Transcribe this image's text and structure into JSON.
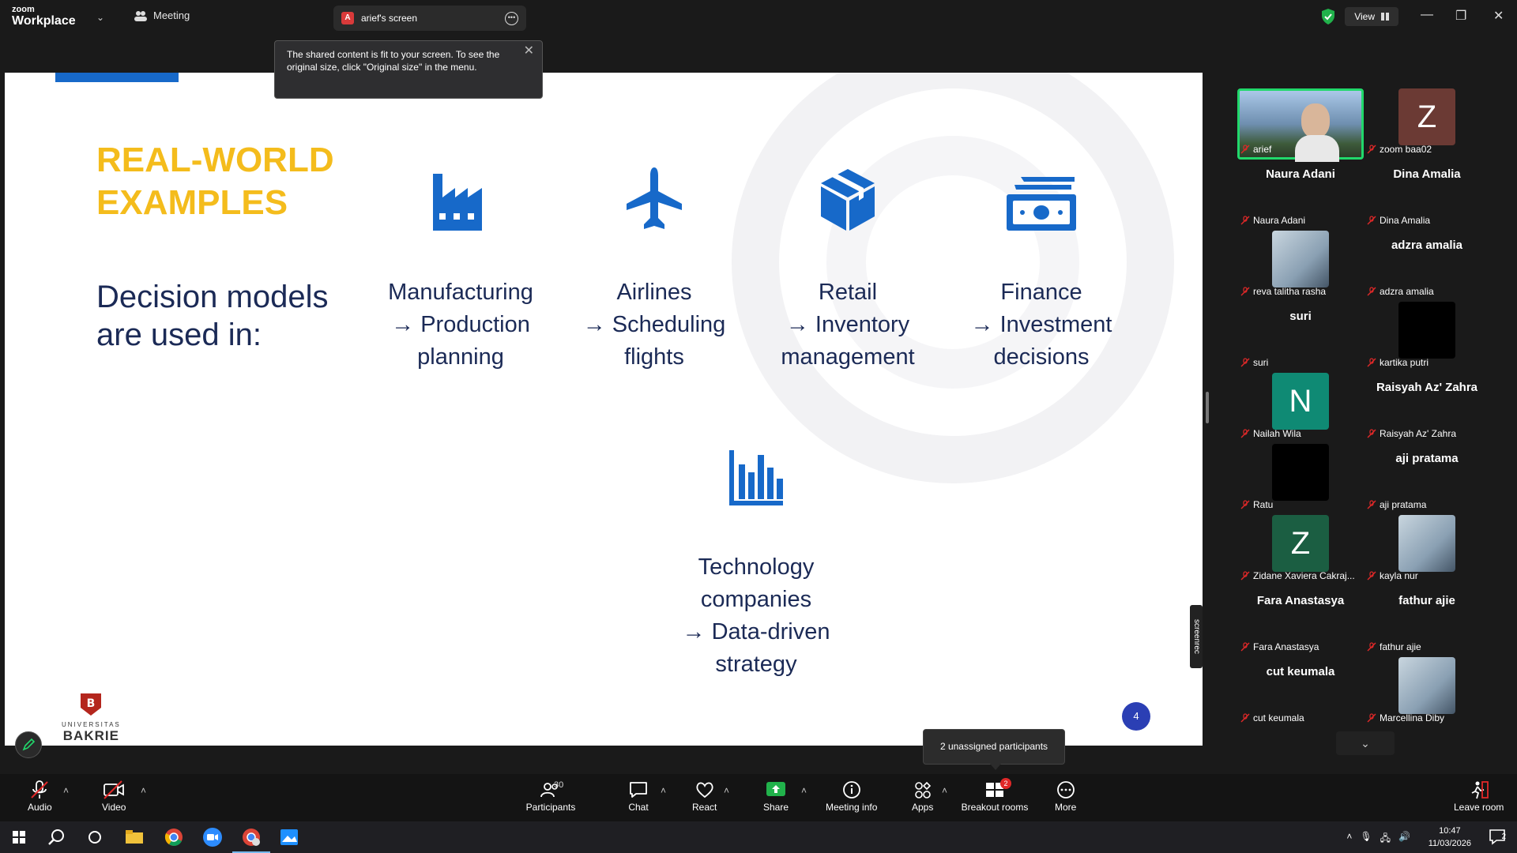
{
  "topbar": {
    "logo_small": "zoom",
    "logo_big": "Workplace",
    "meeting_label": "Meeting",
    "share_avatar": "A",
    "share_title": "arief's screen",
    "view_label": "View"
  },
  "tooltip": {
    "text": "The shared content is fit to your screen. To see the original size, click \"Original size\" in the menu."
  },
  "slide": {
    "title_line1": "REAL-WORLD",
    "title_line2": "EXAMPLES",
    "subtitle": "Decision models are used in:",
    "examples": [
      {
        "icon": "factory-icon",
        "label": "Manufacturing\n→ Production\nplanning"
      },
      {
        "icon": "airplane-icon",
        "label": "Airlines\n→ Scheduling\nflights"
      },
      {
        "icon": "package-icon",
        "label": "Retail\n→ Inventory\nmanagement"
      },
      {
        "icon": "money-icon",
        "label": "Finance\n→ Investment\ndecisions"
      },
      {
        "icon": "bar-chart-icon",
        "label": "Technology\ncompanies\n→ Data-driven\nstrategy"
      }
    ],
    "logo_crest": "B",
    "logo_uni": "UNIVERSITAS",
    "logo_name": "BAKRIE",
    "page_number": "4",
    "accent_blue": "#1769c9",
    "title_color": "#f4bc1c"
  },
  "screenrec": "screenrec",
  "participants": [
    {
      "label": "arief",
      "kind": "video"
    },
    {
      "label": "zoom baa02",
      "kind": "avatar",
      "initial": "Z",
      "color": "#6b3a34"
    },
    {
      "label": "Naura Adani",
      "big": "Naura Adani"
    },
    {
      "label": "Dina Amalia",
      "big": "Dina Amalia"
    },
    {
      "label": "reva talitha rasha",
      "kind": "photo"
    },
    {
      "label": "adzra amalia",
      "big": "adzra amalia"
    },
    {
      "label": "suri",
      "big": "suri"
    },
    {
      "label": "kartika putri",
      "kind": "black"
    },
    {
      "label": "Nailah Wila",
      "kind": "avatar",
      "initial": "N",
      "color": "#0f8a74"
    },
    {
      "label": "Raisyah Az' Zahra",
      "big": "Raisyah Az' Zahra"
    },
    {
      "label": "Ratu",
      "kind": "black"
    },
    {
      "label": "aji pratama",
      "big": "aji pratama"
    },
    {
      "label": "Zidane Xaviera Cakraj...",
      "kind": "avatar",
      "initial": "Z",
      "color": "#1b5e42"
    },
    {
      "label": "kayla nur",
      "kind": "photo"
    },
    {
      "label": "Fara Anastasya",
      "big": "Fara Anastasya"
    },
    {
      "label": "fathur ajie",
      "big": "fathur ajie"
    },
    {
      "label": "cut keumala",
      "big": "cut keumala"
    },
    {
      "label": "Marcellina Diby",
      "kind": "photo"
    }
  ],
  "unassigned_tooltip": "2 unassigned participants",
  "toolbar": {
    "audio": "Audio",
    "video": "Video",
    "participants": "Participants",
    "participants_count": "30",
    "chat": "Chat",
    "react": "React",
    "share": "Share",
    "meeting_info": "Meeting info",
    "apps": "Apps",
    "breakout_rooms": "Breakout rooms",
    "breakout_badge": "2",
    "more": "More",
    "leave_room": "Leave room"
  },
  "taskbar": {
    "time": "10:47",
    "date": "11/03/2026",
    "notif_count": "2"
  }
}
